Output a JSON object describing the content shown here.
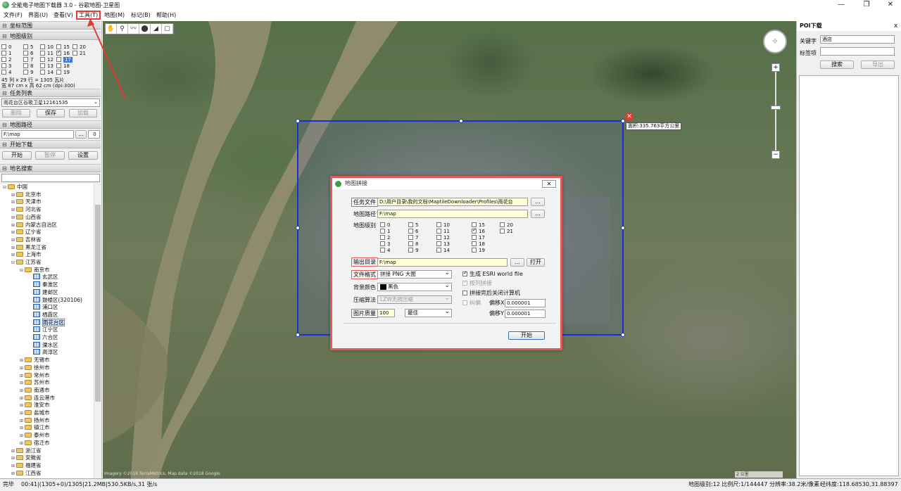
{
  "app": {
    "title": "全能电子地图下载器 3.0 - 谷歌地图-卫星图"
  },
  "window_controls": {
    "minimize": "—",
    "maximize": "❐",
    "close": "✕"
  },
  "menu": [
    "文件(F)",
    "界面(U)",
    "查看(V)",
    "工具(T)",
    "地图(M)",
    "标记(B)",
    "帮助(H)"
  ],
  "left": {
    "coord_section": "坐标范围",
    "level_section": "地图级别",
    "levels": [
      {
        "n": "0",
        "c": false
      },
      {
        "n": "5",
        "c": false
      },
      {
        "n": "10",
        "c": false
      },
      {
        "n": "15",
        "c": false
      },
      {
        "n": "20",
        "c": false
      },
      {
        "n": "1",
        "c": false
      },
      {
        "n": "6",
        "c": false
      },
      {
        "n": "11",
        "c": false
      },
      {
        "n": "16",
        "c": true
      },
      {
        "n": "21",
        "c": false
      },
      {
        "n": "2",
        "c": false
      },
      {
        "n": "7",
        "c": false
      },
      {
        "n": "12",
        "c": false
      },
      {
        "n": "17",
        "c": false,
        "hl": true
      },
      {
        "n": "3",
        "c": false
      },
      {
        "n": "8",
        "c": false
      },
      {
        "n": "13",
        "c": false
      },
      {
        "n": "18",
        "c": false
      },
      {
        "n": "4",
        "c": false
      },
      {
        "n": "9",
        "c": false
      },
      {
        "n": "14",
        "c": false
      },
      {
        "n": "19",
        "c": false
      }
    ],
    "info_line1": "45 列 x 29 行 = 1305 瓦片",
    "info_line2": "宽 87 cm x 高 62 cm (dpi:300)",
    "task_section": "任务列表",
    "task_value": "雨花台区谷歌卫星12161535",
    "btn_delete": "删除",
    "btn_save": "保存",
    "btn_load": "加载",
    "path_section": "地图路径",
    "path_value": "F:\\map",
    "path_browse": "...",
    "path_count": "0",
    "download_section": "开始下载",
    "btn_start": "开始",
    "btn_pause": "暂停",
    "btn_settings": "设置",
    "search_section": "地名搜索",
    "tree": [
      {
        "label": "中国",
        "lvl": 0,
        "type": "folder",
        "exp": "⊟"
      },
      {
        "label": "北京市",
        "lvl": 1,
        "type": "folder",
        "exp": "⊞"
      },
      {
        "label": "天津市",
        "lvl": 1,
        "type": "folder",
        "exp": "⊞"
      },
      {
        "label": "河北省",
        "lvl": 1,
        "type": "folder",
        "exp": "⊞"
      },
      {
        "label": "山西省",
        "lvl": 1,
        "type": "folder",
        "exp": "⊞"
      },
      {
        "label": "内蒙古自治区",
        "lvl": 1,
        "type": "folder",
        "exp": "⊞"
      },
      {
        "label": "辽宁省",
        "lvl": 1,
        "type": "folder",
        "exp": "⊞"
      },
      {
        "label": "吉林省",
        "lvl": 1,
        "type": "folder",
        "exp": "⊞"
      },
      {
        "label": "黑龙江省",
        "lvl": 1,
        "type": "folder",
        "exp": "⊞"
      },
      {
        "label": "上海市",
        "lvl": 1,
        "type": "folder",
        "exp": "⊞"
      },
      {
        "label": "江苏省",
        "lvl": 1,
        "type": "folder",
        "exp": "⊟"
      },
      {
        "label": "南京市",
        "lvl": 2,
        "type": "folder",
        "exp": "⊟"
      },
      {
        "label": "玄武区",
        "lvl": 3,
        "type": "grid",
        "exp": ""
      },
      {
        "label": "秦淮区",
        "lvl": 3,
        "type": "grid",
        "exp": ""
      },
      {
        "label": "建邺区",
        "lvl": 3,
        "type": "grid",
        "exp": ""
      },
      {
        "label": "鼓楼区(320106)",
        "lvl": 3,
        "type": "grid",
        "exp": ""
      },
      {
        "label": "浦口区",
        "lvl": 3,
        "type": "grid",
        "exp": ""
      },
      {
        "label": "栖霞区",
        "lvl": 3,
        "type": "grid",
        "exp": ""
      },
      {
        "label": "雨花台区",
        "lvl": 3,
        "type": "grid",
        "exp": "",
        "sel": true
      },
      {
        "label": "江宁区",
        "lvl": 3,
        "type": "grid",
        "exp": ""
      },
      {
        "label": "六合区",
        "lvl": 3,
        "type": "grid",
        "exp": ""
      },
      {
        "label": "溧水区",
        "lvl": 3,
        "type": "grid",
        "exp": ""
      },
      {
        "label": "高淳区",
        "lvl": 3,
        "type": "grid",
        "exp": ""
      },
      {
        "label": "无锡市",
        "lvl": 2,
        "type": "folder",
        "exp": "⊞"
      },
      {
        "label": "徐州市",
        "lvl": 2,
        "type": "folder",
        "exp": "⊞"
      },
      {
        "label": "常州市",
        "lvl": 2,
        "type": "folder",
        "exp": "⊞"
      },
      {
        "label": "苏州市",
        "lvl": 2,
        "type": "folder",
        "exp": "⊞"
      },
      {
        "label": "南通市",
        "lvl": 2,
        "type": "folder",
        "exp": "⊞"
      },
      {
        "label": "连云港市",
        "lvl": 2,
        "type": "folder",
        "exp": "⊞"
      },
      {
        "label": "淮安市",
        "lvl": 2,
        "type": "folder",
        "exp": "⊞"
      },
      {
        "label": "盐城市",
        "lvl": 2,
        "type": "folder",
        "exp": "⊞"
      },
      {
        "label": "扬州市",
        "lvl": 2,
        "type": "folder",
        "exp": "⊞"
      },
      {
        "label": "镇江市",
        "lvl": 2,
        "type": "folder",
        "exp": "⊞"
      },
      {
        "label": "泰州市",
        "lvl": 2,
        "type": "folder",
        "exp": "⊞"
      },
      {
        "label": "宿迁市",
        "lvl": 2,
        "type": "folder",
        "exp": "⊞"
      },
      {
        "label": "浙江省",
        "lvl": 1,
        "type": "folder",
        "exp": "⊞"
      },
      {
        "label": "安徽省",
        "lvl": 1,
        "type": "folder",
        "exp": "⊞"
      },
      {
        "label": "福建省",
        "lvl": 1,
        "type": "folder",
        "exp": "⊞"
      },
      {
        "label": "江西省",
        "lvl": 1,
        "type": "folder",
        "exp": "⊞"
      }
    ]
  },
  "map": {
    "tools": [
      "✋",
      "⚲",
      "〰",
      "⬤",
      "◢",
      "▢"
    ],
    "area_label": "面积:335.763平方公里",
    "close_x": "✕",
    "nav_arrows": "⊹",
    "zoom_in": "+",
    "zoom_out": "−",
    "scale_text": "2 公里",
    "copyright": "Imagery ©2018 TerraMetrics, Map data ©2018 Google"
  },
  "poi": {
    "title": "POI下载",
    "close": "x",
    "keyword_label": "关键字",
    "keyword_value": "酒店",
    "tag_label": "标签项",
    "tag_value": "",
    "btn_search": "搜索",
    "btn_export": "导出"
  },
  "dialog": {
    "title": "地图拼接",
    "close": "✕",
    "task_file_label": "任务文件",
    "task_file_value": "D:\\用户目录\\我的文档\\MaptileDownloader\\Profiles\\雨花台",
    "map_path_label": "地图路径",
    "map_path_value": "F:\\map",
    "browse": "...",
    "level_label": "地图级别",
    "levels": [
      {
        "n": "0",
        "c": false
      },
      {
        "n": "5",
        "c": false
      },
      {
        "n": "10",
        "c": false
      },
      {
        "n": "15",
        "c": false
      },
      {
        "n": "20",
        "c": false
      },
      {
        "n": "1",
        "c": false
      },
      {
        "n": "6",
        "c": false
      },
      {
        "n": "11",
        "c": false
      },
      {
        "n": "16",
        "c": true
      },
      {
        "n": "21",
        "c": false
      },
      {
        "n": "2",
        "c": false
      },
      {
        "n": "7",
        "c": false
      },
      {
        "n": "12",
        "c": false
      },
      {
        "n": "17",
        "c": false
      },
      {
        "n": "3",
        "c": false
      },
      {
        "n": "8",
        "c": false
      },
      {
        "n": "13",
        "c": false
      },
      {
        "n": "18",
        "c": false
      },
      {
        "n": "4",
        "c": false
      },
      {
        "n": "9",
        "c": false
      },
      {
        "n": "14",
        "c": false
      },
      {
        "n": "19",
        "c": false
      }
    ],
    "output_label": "输出目录",
    "output_value": "F:\\map",
    "open_btn": "打开",
    "format_label": "文件格式",
    "format_value": "拼接 PNG 大图",
    "esri_label": "生成 ESRI world file",
    "bycol_label": "按列拼接",
    "bgcolor_label": "背景颜色",
    "bgcolor_value": "黑色",
    "shutdown_label": "拼接完后关闭计算机",
    "compress_label": "压缩算法",
    "compress_value": "LZW无损压缩",
    "correct_label": "纠偏",
    "offx_label": "偏移X",
    "offx_value": "0.000001",
    "offy_label": "偏移Y",
    "offy_value": "0.000001",
    "quality_label": "图片质量",
    "quality_value": "100",
    "quality_level": "最佳",
    "start_btn": "开始"
  },
  "status": {
    "left": "完毕",
    "progress": "00:41|(1305+0)/1305|21.2MB|530.5KB/s,31 张/s",
    "level": "地图级别:12 比例尺:1/144447 分辨率:38.2米/像素",
    "coords": "经纬度:118.68530,31.88397"
  }
}
